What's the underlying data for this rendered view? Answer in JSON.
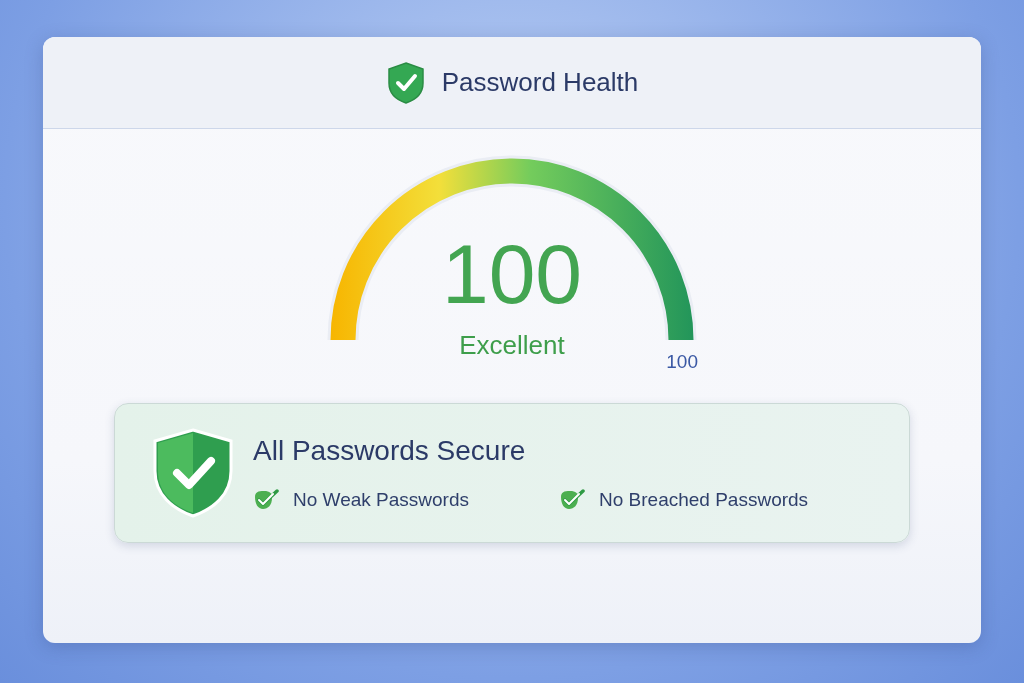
{
  "header": {
    "title": "Password Health"
  },
  "gauge": {
    "level": 1,
    "score": "100",
    "rating": "Excellent",
    "max_label": "100"
  },
  "status": {
    "title": "All Passwords Secure",
    "secure": true,
    "checks": [
      {
        "label": "No Weak Passwords",
        "passed": true
      },
      {
        "label": "No Breached Passwords",
        "passed": true
      }
    ]
  }
}
